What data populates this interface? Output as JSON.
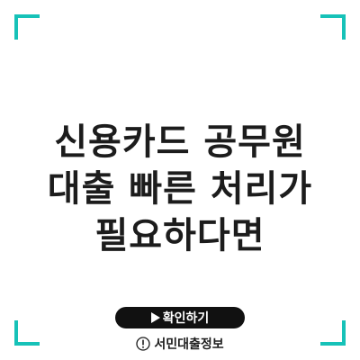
{
  "headline": {
    "line1": "신용카드 공무원",
    "line2": "대출 빠른 처리가",
    "line3": "필요하다면"
  },
  "cta": {
    "label": "확인하기",
    "icon": "play-triangle-icon"
  },
  "source": {
    "icon": "exclamation-circle-icon",
    "label": "서민대출정보"
  },
  "colors": {
    "accent": "#16c2b8",
    "text": "#1c1c1c",
    "button_bg": "#111111",
    "background": "#ffffff"
  }
}
